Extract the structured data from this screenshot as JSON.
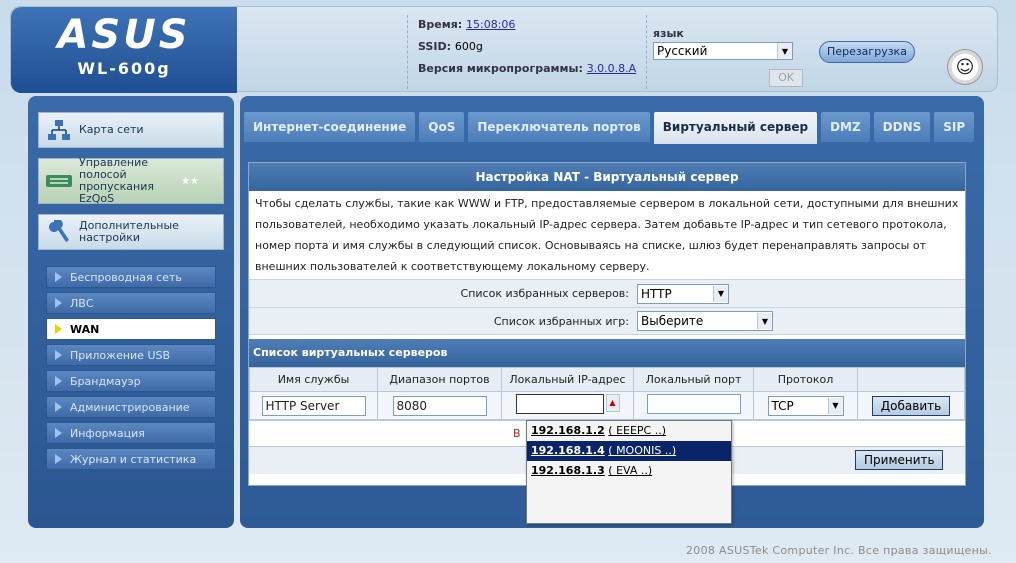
{
  "header": {
    "brand": "ASUS",
    "model": "WL-600g",
    "time_label": "Время:",
    "time_value": "15:08:06",
    "ssid_label": "SSID:",
    "ssid_value": "600g",
    "fw_label": "Версия микропрограммы:",
    "fw_value": "3.0.0.8.A",
    "lang_label": "язык",
    "lang_value": "Русский",
    "ok_label": "OK",
    "reboot_label": "Перезагрузка"
  },
  "sidebar": {
    "big_items": [
      {
        "label": "Карта сети"
      },
      {
        "label": "Управление полосой пропускания EzQoS"
      },
      {
        "label": "Дополнительные настройки"
      }
    ],
    "items": [
      {
        "label": "Беспроводная сеть"
      },
      {
        "label": "ЛВС"
      },
      {
        "label": "WAN"
      },
      {
        "label": "Приложение USB"
      },
      {
        "label": "Брандмауэр"
      },
      {
        "label": "Администрирование"
      },
      {
        "label": "Информация"
      },
      {
        "label": "Журнал и статистика"
      }
    ]
  },
  "tabs": [
    {
      "label": "Интернет-соединение"
    },
    {
      "label": "QoS"
    },
    {
      "label": "Переключатель портов"
    },
    {
      "label": "Виртуальный сервер"
    },
    {
      "label": "DMZ"
    },
    {
      "label": "DDNS"
    },
    {
      "label": "SIP"
    }
  ],
  "content": {
    "title": "Настройка NAT - Виртуальный сервер",
    "description": "Чтобы сделать службы, такие как WWW и FTP, предоставляемые сервером в локальной сети, доступными для внешних пользователей, необходимо указать локальный IP-адрес сервера. Затем добавьте IP-адрес и тип сетевого протокола, номер порта и имя службы в следующий список. Основываясь на списке, шлюз будет перенаправлять запросы от внешних пользователей к соответствующему локальному серверу.",
    "fav_servers_label": "Список избранных серверов:",
    "fav_servers_value": "HTTP",
    "fav_games_label": "Список избранных игр:",
    "fav_games_value": "Выберите",
    "list_title": "Список виртуальных серверов",
    "columns": [
      "Имя службы",
      "Диапазон портов",
      "Локальный IP-адрес",
      "Локальный порт",
      "Протокол",
      ""
    ],
    "row": {
      "service": "HTTP Server",
      "port_range": "8080",
      "local_ip": "",
      "local_port": "",
      "protocol": "TCP",
      "add_label": "Добавить"
    },
    "empty_msg_fragment": "В",
    "apply_label": "Применить"
  },
  "dropdown": {
    "items": [
      {
        "ip": "192.168.1.2",
        "name": "( EEEPC ..)",
        "selected": false
      },
      {
        "ip": "192.168.1.4",
        "name": "( MOONIS ..)",
        "selected": true
      },
      {
        "ip": "192.168.1.3",
        "name": "( EVA ..)",
        "selected": false
      }
    ]
  },
  "footer": "2008 ASUSTek Computer Inc. Все права защищены."
}
